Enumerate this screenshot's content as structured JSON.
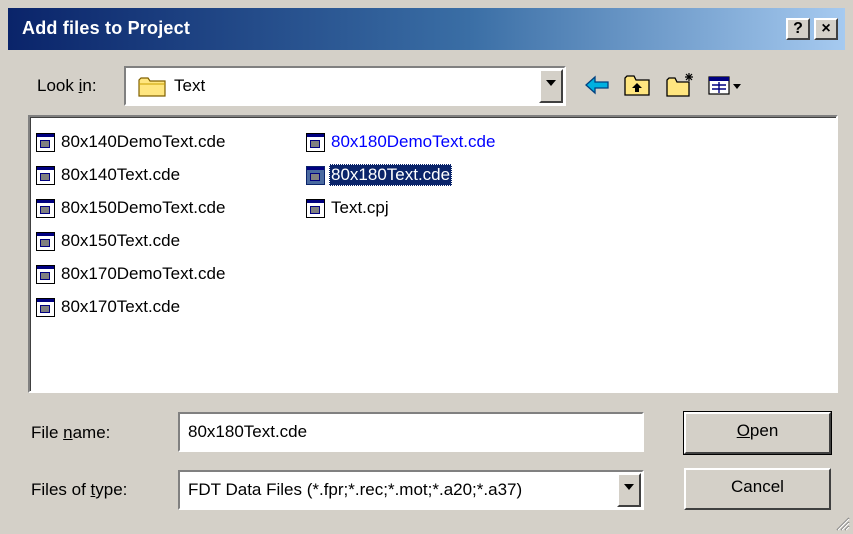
{
  "window": {
    "title": "Add files to Project",
    "help_button": "?",
    "close_button": "×"
  },
  "look_in": {
    "label_pre": "Look ",
    "label_accel": "i",
    "label_post": "n:",
    "value": "Text",
    "icon": "folder-icon"
  },
  "toolbar": {
    "back": "back-arrow-icon",
    "up": "up-folder-icon",
    "new_folder": "new-folder-icon",
    "view_menu": "view-menu-icon"
  },
  "files": [
    {
      "name": "80x140DemoText.cde",
      "state": "normal"
    },
    {
      "name": "80x140Text.cde",
      "state": "normal"
    },
    {
      "name": "80x150DemoText.cde",
      "state": "normal"
    },
    {
      "name": "80x150Text.cde",
      "state": "normal"
    },
    {
      "name": "80x170DemoText.cde",
      "state": "normal"
    },
    {
      "name": "80x170Text.cde",
      "state": "normal"
    },
    {
      "name": "80x180DemoText.cde",
      "state": "highlighted"
    },
    {
      "name": "80x180Text.cde",
      "state": "selected"
    },
    {
      "name": "Text.cpj",
      "state": "normal"
    }
  ],
  "file_name": {
    "label_pre": "File ",
    "label_accel": "n",
    "label_post": "ame:",
    "value": "80x180Text.cde"
  },
  "file_type": {
    "label_pre": "Files of ",
    "label_accel": "t",
    "label_post": "ype:",
    "value": "FDT Data Files (*.fpr;*.rec;*.mot;*.a20;*.a37)"
  },
  "buttons": {
    "open_accel": "O",
    "open_rest": "pen",
    "cancel": "Cancel"
  },
  "colors": {
    "title_start": "#0a246a",
    "title_end": "#a6caf0",
    "selection": "#0a246a",
    "link_blue": "#0000ff",
    "face": "#d4d0c8"
  }
}
